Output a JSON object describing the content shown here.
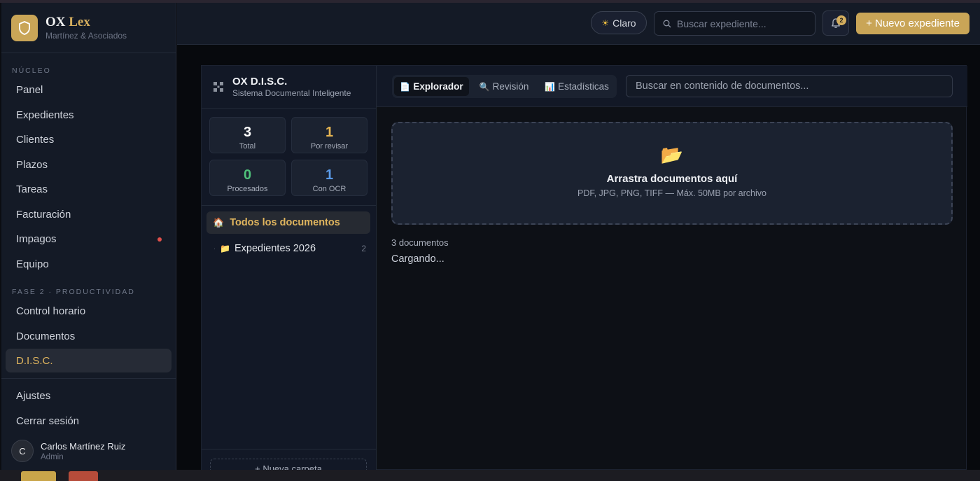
{
  "brand": {
    "name_prefix": "OX",
    "name_accent": "Lex",
    "subtitle": "Martínez & Asociados"
  },
  "sidebar": {
    "section_core": "NÚCLEO",
    "section_phase2": "FASE 2 · PRODUCTIVIDAD",
    "core_items": [
      {
        "label": "Panel"
      },
      {
        "label": "Expedientes"
      },
      {
        "label": "Clientes"
      },
      {
        "label": "Plazos"
      },
      {
        "label": "Tareas"
      },
      {
        "label": "Facturación"
      },
      {
        "label": "Impagos"
      },
      {
        "label": "Equipo"
      }
    ],
    "phase2_items": [
      {
        "label": "Control horario"
      },
      {
        "label": "Documentos"
      },
      {
        "label": "D.I.S.C.",
        "active": true
      }
    ],
    "footer_items": [
      {
        "label": "Ajustes"
      },
      {
        "label": "Cerrar sesión"
      }
    ],
    "user": {
      "initial": "C",
      "name": "Carlos Martínez Ruiz",
      "role": "Admin"
    }
  },
  "header": {
    "theme_label": "Claro",
    "search_placeholder": "Buscar expediente...",
    "notifications_count": "2",
    "new_button": "+ Nuevo expediente"
  },
  "disc": {
    "title": "OX D.I.S.C.",
    "subtitle": "Sistema Documental Inteligente",
    "stats": [
      {
        "value": "3",
        "label": "Total",
        "color": "#ffffff"
      },
      {
        "value": "1",
        "label": "Por revisar",
        "color": "#e5b552"
      },
      {
        "value": "0",
        "label": "Procesados",
        "color": "#4fc27a"
      },
      {
        "value": "1",
        "label": "Con OCR",
        "color": "#5a9ae8"
      }
    ],
    "tree": {
      "all_label": "Todos los documentos",
      "folders": [
        {
          "name": "Expedientes 2026",
          "count": "2"
        }
      ]
    },
    "new_folder_button": "+ Nueva carpeta",
    "tabs": [
      {
        "icon": "📄",
        "label": "Explorador",
        "active": true
      },
      {
        "icon": "🔍",
        "label": "Revisión"
      },
      {
        "icon": "📊",
        "label": "Estadísticas"
      }
    ],
    "content_search_placeholder": "Buscar en contenido de documentos...",
    "dropzone": {
      "title": "Arrastra documentos aquí",
      "subtitle": "PDF, JPG, PNG, TIFF — Máx. 50MB por archivo"
    },
    "doc_count": "3 documentos",
    "loading": "Cargando..."
  },
  "colors": {
    "accent": "#c9a557",
    "accent_text": "#e0b55e",
    "danger": "#e0504b"
  }
}
